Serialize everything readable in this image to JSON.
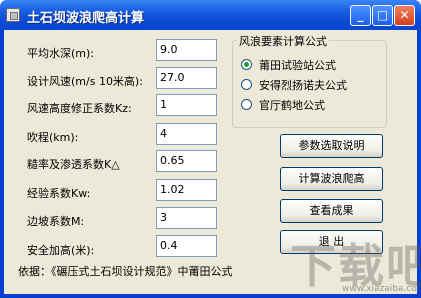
{
  "window": {
    "title": "土石坝波浪爬高计算"
  },
  "titlebar_buttons": {
    "minimize": "_",
    "maximize": "□",
    "close": "✕"
  },
  "inputs": [
    {
      "label": "平均水深(m):",
      "value": "9.0"
    },
    {
      "label": "设计风速(m/s 10米高):",
      "value": "27.0"
    },
    {
      "label": "风速高度修正系数Kz:",
      "value": "1"
    },
    {
      "label": "吹程(km):",
      "value": "4"
    },
    {
      "label": "糙率及渗透系数K△",
      "value": "0.65"
    },
    {
      "label": "经验系数Kw:",
      "value": "1.02"
    },
    {
      "label": "边坡系数M:",
      "value": "3"
    },
    {
      "label": "安全加高(米):",
      "value": "0.4"
    }
  ],
  "formula_group": {
    "title": "风浪要素计算公式",
    "options": [
      {
        "label": "莆田试验站公式",
        "selected": true
      },
      {
        "label": "安得烈扬诺夫公式",
        "selected": false
      },
      {
        "label": "官厅鹤地公式",
        "selected": false
      }
    ]
  },
  "buttons": {
    "param_help": "参数选取说明",
    "calculate": "计算波浪爬高",
    "view_results": "查看成果",
    "exit": "退 出"
  },
  "footer": {
    "basis": "依据：《碾压式土石坝设计规范》中莆田公式"
  },
  "watermark": {
    "text": "下载吧",
    "url": "www.xiazaiba.com"
  }
}
